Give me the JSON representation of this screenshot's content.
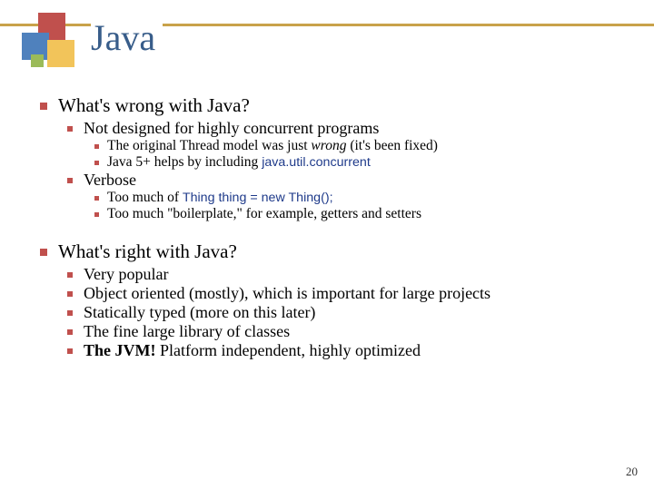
{
  "title": "Java",
  "pageNumber": "20",
  "sections": [
    {
      "heading": "What's wrong with Java?",
      "items": [
        {
          "text": "Not designed for highly concurrent programs",
          "sub": [
            {
              "pre": "The original Thread model was just ",
              "italic": "wrong",
              "post": " (it's been fixed)"
            },
            {
              "pre": "Java 5+ helps by including ",
              "code": "java.util.concurrent",
              "post": ""
            }
          ]
        },
        {
          "text": "Verbose",
          "sub": [
            {
              "pre": "Too much of ",
              "code": "Thing thing = new Thing();",
              "post": ""
            },
            {
              "pre": "Too much \"boilerplate,\" for example, getters and setters"
            }
          ]
        }
      ]
    },
    {
      "heading": "What's right with Java?",
      "items": [
        {
          "text": "Very popular"
        },
        {
          "text": "Object oriented (mostly), which is important for large projects"
        },
        {
          "text": "Statically typed (more on this later)"
        },
        {
          "text": "The fine large library of classes"
        },
        {
          "bold": "The JVM!",
          "text": " Platform independent, highly optimized"
        }
      ]
    }
  ]
}
